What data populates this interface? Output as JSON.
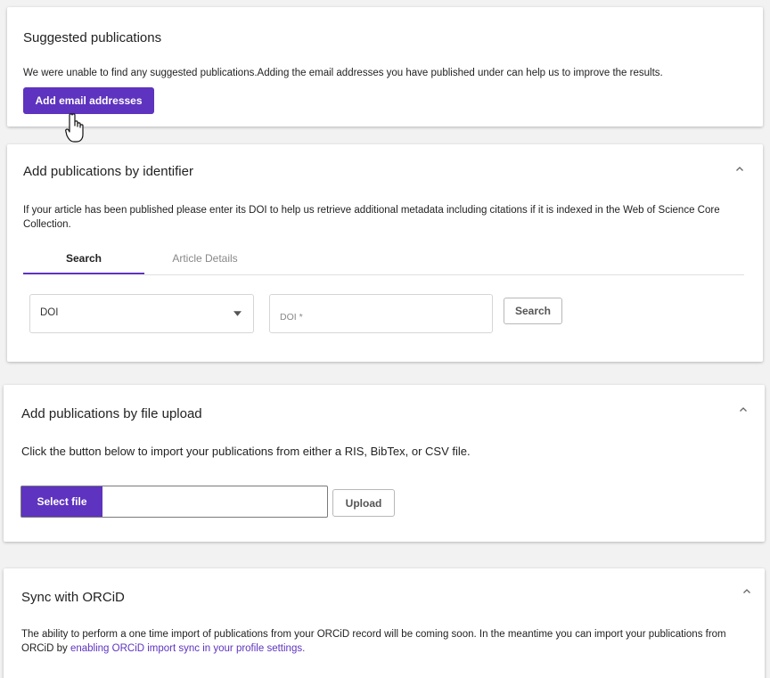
{
  "suggested": {
    "title": "Suggested publications",
    "description": "We were unable to find any suggested publications.Adding the email addresses you have published under can help us to improve the results.",
    "button_label": "Add email addresses"
  },
  "identifier": {
    "title": "Add publications by identifier",
    "description": "If your article has been published please enter its DOI to help us retrieve additional metadata including citations if it is indexed in the Web of Science Core Collection.",
    "tabs": [
      {
        "label": "Search",
        "active": true
      },
      {
        "label": "Article Details",
        "active": false
      }
    ],
    "select_value": "DOI",
    "input_placeholder": "DOI *",
    "search_button_label": "Search"
  },
  "file_upload": {
    "title": "Add publications by file upload",
    "description": "Click the button below to import your publications from either a RIS, BibTex, or CSV file.",
    "select_file_label": "Select file",
    "upload_button_label": "Upload"
  },
  "orcid": {
    "title": "Sync with ORCiD",
    "description_prefix": "The ability to perform a one time import of publications from your ORCiD record will be coming soon. In the meantime you can import your publications from ORCiD by ",
    "link_text": "enabling ORCiD import sync in your profile settings."
  },
  "colors": {
    "accent": "#5e33bf",
    "background": "#f2f2f2"
  },
  "icons": {
    "collapse": "chevron-up-icon",
    "dropdown": "caret-down-icon",
    "cursor": "hand-pointer-icon"
  }
}
